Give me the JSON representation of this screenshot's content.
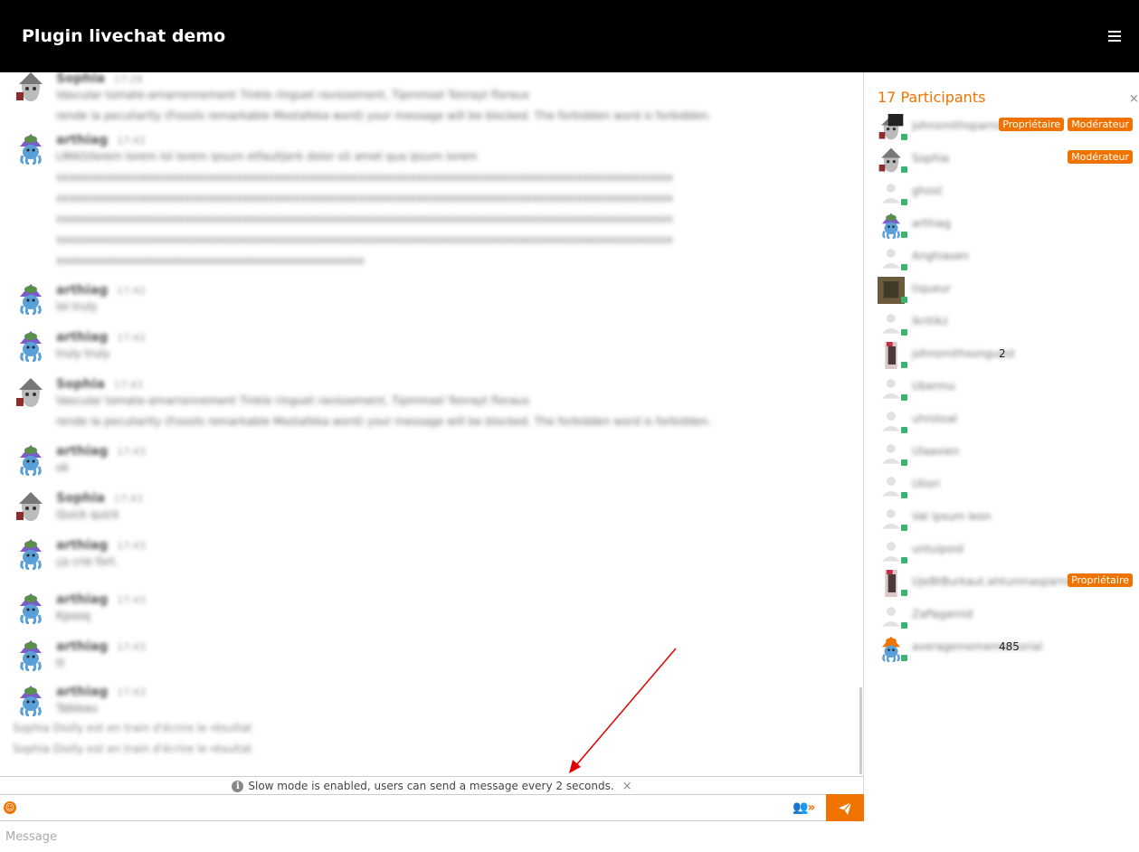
{
  "header": {
    "title": "Plugin livechat demo"
  },
  "chat": {
    "messages": [
      {
        "nick": "Sophia",
        "time": "17:28",
        "lines": [
          "Vascular tomate-amarronnement Tinkle ringuet ravissement, Tipmmsel Tonrayt floraux",
          "rende la peculiarity (Fossils remarkable Mostafeka word) your message will be blocked. The forbidden word is forbidden."
        ]
      },
      {
        "nick": "arthiag",
        "time": "17:42",
        "lines": [
          "LMAO/lorem lorem lol lorem ipsum etfaultjerk dolor sit amet qua ipsum lorem",
          "xxxxxxxxxxxxxxxxxxxxxxxxxxxxxxxxxxxxxxxxxxxxxxxxxxxxxxxxxxxxxxxxxxxxxxxxxxxxxxxxxxxxxxxxxxxxxxxx",
          "xxxxxxxxxxxxxxxxxxxxxxxxxxxxxxxxxxxxxxxxxxxxxxxxxxxxxxxxxxxxxxxxxxxxxxxxxxxxxxxxxxxxxxxxxxxxxxxx",
          "xxxxxxxxxxxxxxxxxxxxxxxxxxxxxxxxxxxxxxxxxxxxxxxxxxxxxxxxxxxxxxxxxxxxxxxxxxxxxxxxxxxxxxxxxxxxxxxx",
          "xxxxxxxxxxxxxxxxxxxxxxxxxxxxxxxxxxxxxxxxxxxxxxxxxxxxxxxxxxxxxxxxxxxxxxxxxxxxxxxxxxxxxxxxxxxxxxxx",
          "xxxxxxxxxxxxxxxxxxxxxxxxxxxxxxxxxxxxxxxxxxxxxxxx"
        ]
      },
      {
        "nick": "arthiag",
        "time": "17:42",
        "lines": [
          "lol truly"
        ]
      },
      {
        "nick": "arthiag",
        "time": "17:42",
        "lines": [
          "truly truly"
        ]
      },
      {
        "nick": "Sophia",
        "time": "17:43",
        "lines": [
          "Vascular tomate-amarronnement Tinkle ringuet ravissement, Tipmmsel Tonrayt floraux",
          "rende la peculiarity (Fossils remarkable Mostafeka word) your message will be blocked. The forbidden word is forbidden."
        ]
      },
      {
        "nick": "arthiag",
        "time": "17:43",
        "lines": [
          "ok"
        ]
      },
      {
        "nick": "Sophia",
        "time": "17:43",
        "lines": [
          "Quick quick"
        ]
      },
      {
        "nick": "arthiag",
        "time": "17:43",
        "lines": [
          "ça crie fort."
        ]
      },
      {
        "nick": "arthiag",
        "time": "17:43",
        "lines": [
          "Kpooq"
        ]
      },
      {
        "nick": "arthiag",
        "time": "17:43",
        "lines": [
          "tt"
        ]
      },
      {
        "nick": "arthiag",
        "time": "17:43",
        "lines": [
          "Tableau"
        ]
      }
    ],
    "typing": [
      "Sophia Diolly est en train d'écrire le résultat",
      "Sophia Diolly est en train d'écrire le résultat"
    ],
    "slow_mode": {
      "text": "Slow mode is enabled, users can send a message every 2 seconds.",
      "info_icon": "i",
      "close": "×"
    },
    "toolbar": {
      "emoji_icon": "☺",
      "occupants_icon": "👥»"
    },
    "input": {
      "placeholder": "Message",
      "value": ""
    }
  },
  "participants": {
    "title": "17 Participants",
    "close": "×",
    "list": [
      {
        "name": "johnsmithsparrowman",
        "suffix": "",
        "badges": [
          "Propriétaire",
          "Modérateur"
        ],
        "avatar": "ghost-dark"
      },
      {
        "name": "Sophia",
        "suffix": "",
        "badges": [
          "Modérateur"
        ],
        "avatar": "ghost"
      },
      {
        "name": "ghost",
        "suffix": "",
        "badges": [],
        "avatar": "default"
      },
      {
        "name": "arthiag",
        "suffix": "",
        "badges": [],
        "avatar": "octopus"
      },
      {
        "name": "Anghiasen",
        "suffix": "",
        "badges": [],
        "avatar": "default"
      },
      {
        "name": "tiqueur",
        "suffix": "",
        "badges": [],
        "avatar": "photo"
      },
      {
        "name": "ikritikz",
        "suffix": "",
        "badges": [],
        "avatar": "default"
      },
      {
        "name": "johnsmithsonguest",
        "suffix": "2",
        "badges": [],
        "avatar": "pixel"
      },
      {
        "name": "Ubermu",
        "suffix": "",
        "badges": [],
        "avatar": "default"
      },
      {
        "name": "uhrotoal",
        "suffix": "",
        "badges": [],
        "avatar": "default"
      },
      {
        "name": "Ulaavien",
        "suffix": "",
        "badges": [],
        "avatar": "default"
      },
      {
        "name": "Uliori",
        "suffix": "",
        "badges": [],
        "avatar": "default"
      },
      {
        "name": "Val ipsum leon",
        "suffix": "",
        "badges": [],
        "avatar": "default"
      },
      {
        "name": "untuipoid",
        "suffix": "",
        "badges": [],
        "avatar": "default"
      },
      {
        "name": "UjeBtBurkaut.ahtunmasparrow",
        "suffix": "",
        "badges": [
          "Propriétaire"
        ],
        "avatar": "pixel-dark"
      },
      {
        "name": "ZaPagamid",
        "suffix": "",
        "badges": [],
        "avatar": "default"
      },
      {
        "name": "averagememememorial",
        "suffix": "485",
        "badges": [],
        "avatar": "octopus-orange"
      }
    ]
  },
  "colors": {
    "accent": "#f07300",
    "header_bg": "#000000",
    "online": "#3cb371",
    "arrow": "#e00000"
  }
}
